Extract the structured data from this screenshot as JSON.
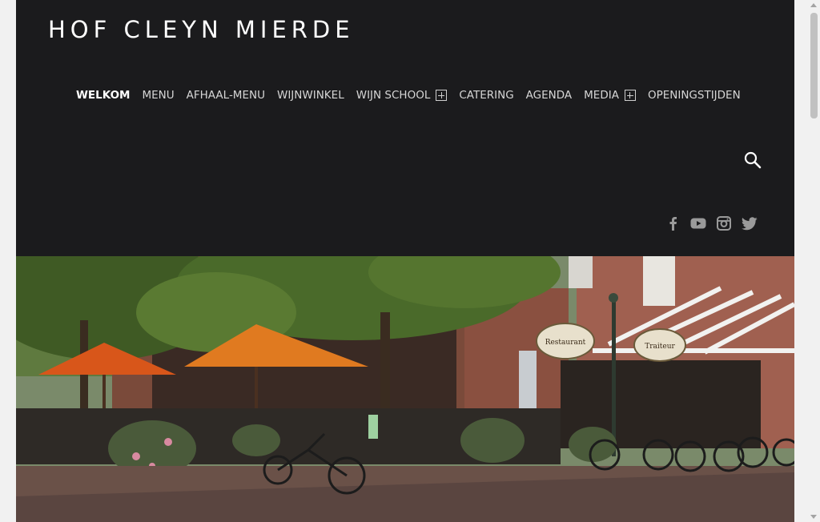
{
  "site": {
    "title": "HOF CLEYN MIERDE"
  },
  "nav": {
    "items": [
      {
        "label": "WELKOM",
        "active": true,
        "has_submenu": false
      },
      {
        "label": "MENU",
        "active": false,
        "has_submenu": false
      },
      {
        "label": "AFHAAL-MENU",
        "active": false,
        "has_submenu": false
      },
      {
        "label": "WIJNWINKEL",
        "active": false,
        "has_submenu": false
      },
      {
        "label": "WIJN SCHOOL",
        "active": false,
        "has_submenu": true
      },
      {
        "label": "CATERING",
        "active": false,
        "has_submenu": false
      },
      {
        "label": "AGENDA",
        "active": false,
        "has_submenu": false
      },
      {
        "label": "MEDIA",
        "active": false,
        "has_submenu": true
      },
      {
        "label": "OPENINGSTIJDEN",
        "active": false,
        "has_submenu": false
      }
    ]
  },
  "search": {
    "icon": "search-icon"
  },
  "social": {
    "icons": [
      "facebook-icon",
      "youtube-icon",
      "instagram-icon",
      "twitter-icon"
    ]
  },
  "hero": {
    "signs": {
      "restaurant": "Restaurant",
      "traiteur": "Traiteur"
    }
  },
  "colors": {
    "header_bg": "#1b1b1d",
    "nav_text": "#d6d6d6",
    "active_text": "#ffffff",
    "icon_gray": "#9a9a9a",
    "page_bg": "#f1f1f1"
  }
}
